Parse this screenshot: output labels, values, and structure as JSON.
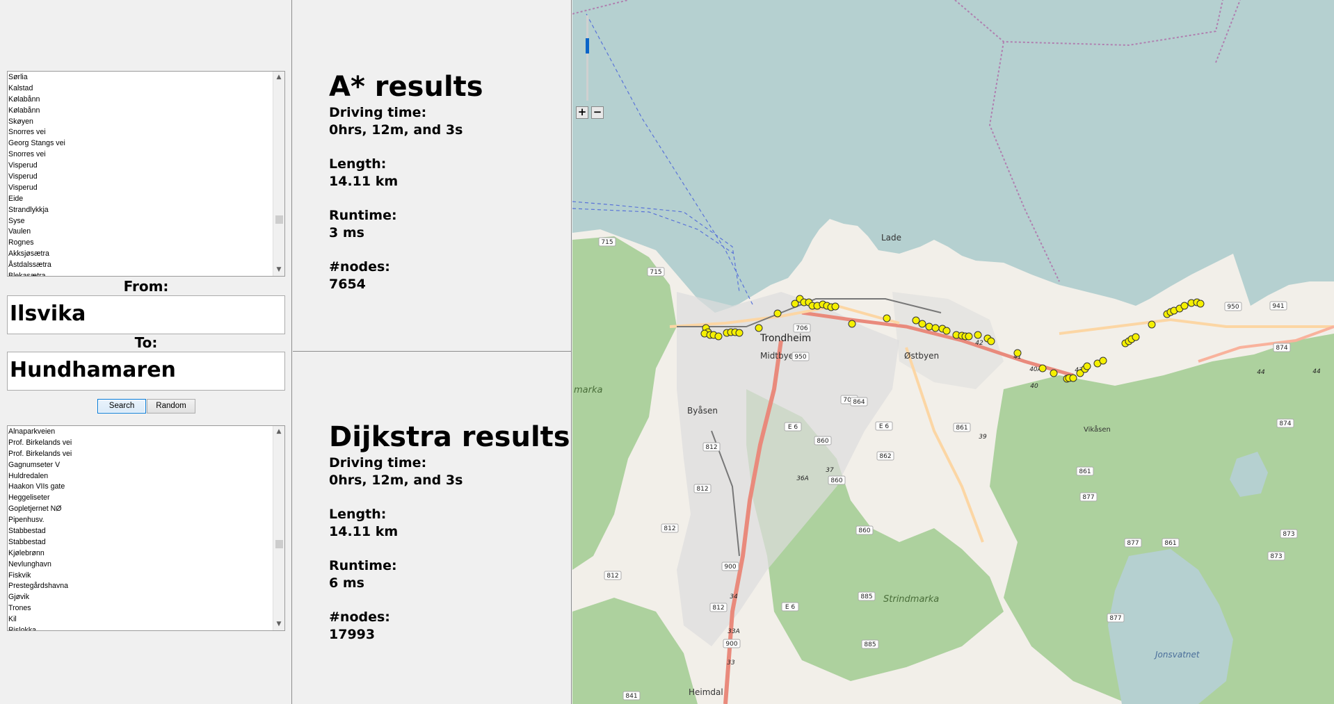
{
  "from_list": {
    "items": [
      "Sørlia",
      "Kalstad",
      "Kølabånn",
      "Kølabånn",
      "Skøyen",
      "Snorres vei",
      "Georg Stangs vei",
      "Snorres vei",
      "Visperud",
      "Visperud",
      "Visperud",
      "Eide",
      "Strandlykkja",
      "Syse",
      "Vaulen",
      "Rognes",
      "Akksjøsætra",
      "Åstdalssætra",
      "Blekasætra"
    ]
  },
  "from": {
    "label": "From:",
    "value": "Ilsvika"
  },
  "to": {
    "label": "To:",
    "value": "Hundhamaren"
  },
  "buttons": {
    "search": "Search",
    "random": "Random"
  },
  "to_list": {
    "items": [
      "Alnaparkveien",
      "Prof. Birkelands vei",
      "Prof. Birkelands vei",
      "Gagnumseter V",
      "Huldredalen",
      "Haakon VIIs gate",
      "Heggeliseter",
      "Gopletjernet NØ",
      "Pipenhusv.",
      "Stabbestad",
      "Stabbestad",
      "Kjølebrønn",
      "Nevlunghavn",
      "Fiskvik",
      "Prestegårdshavna",
      "Gjøvik",
      "Trones",
      "Kil",
      "Rislokka"
    ]
  },
  "astar": {
    "title": "A* results",
    "driving_time_label": "Driving time:",
    "driving_time": "0hrs, 12m, and 3s",
    "length_label": "Length:",
    "length": "14.11 km",
    "runtime_label": "Runtime:",
    "runtime": "3 ms",
    "nodes_label": "#nodes:",
    "nodes": "7654"
  },
  "dijkstra": {
    "title": "Dijkstra results",
    "driving_time_label": "Driving time:",
    "driving_time": "0hrs, 12m, and 3s",
    "length_label": "Length:",
    "length": "14.11 km",
    "runtime_label": "Runtime:",
    "runtime": "6 ms",
    "nodes_label": "#nodes:",
    "nodes": "17993"
  },
  "map": {
    "zoom_in": "+",
    "zoom_out": "−",
    "labels": {
      "trondheim": "Trondheim",
      "midtbyen": "Midtbyen",
      "lade": "Lade",
      "ostbyen": "Østbyen",
      "byasen": "Byåsen",
      "strindmarka": "Strindmarka",
      "jonsvatnet": "Jonsvatnet",
      "heimdal": "Heimdal",
      "vikasen": "Vikåsen",
      "marka": "marka"
    },
    "shields": [
      "715",
      "715",
      "706",
      "706",
      "E 6",
      "E 6",
      "E 6",
      "812",
      "812",
      "812",
      "812",
      "812",
      "860",
      "860",
      "860",
      "861",
      "861",
      "861",
      "862",
      "864",
      "873",
      "873",
      "874",
      "874",
      "877",
      "877",
      "877",
      "885",
      "885",
      "900",
      "900",
      "950",
      "941",
      "950",
      "841",
      "44",
      "44",
      "42",
      "43A",
      "40A",
      "40",
      "41",
      "39",
      "37",
      "36A",
      "34",
      "33A",
      "33"
    ],
    "marker_color": "#f5f000",
    "water_color": "#b5d0d0",
    "land_color": "#f2efe9",
    "forest_color": "#add19e"
  }
}
